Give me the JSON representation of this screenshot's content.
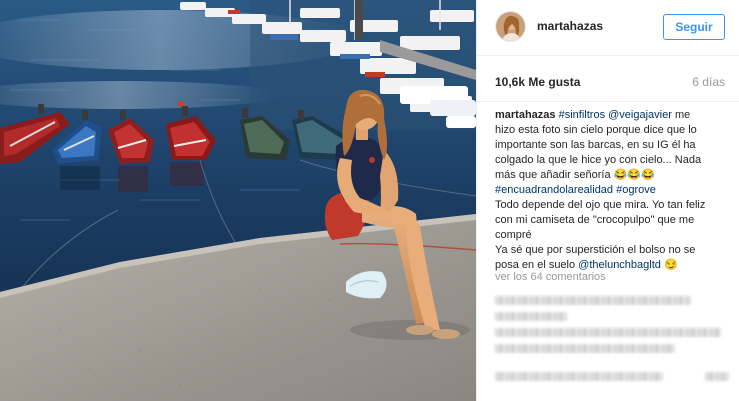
{
  "post": {
    "username": "martahazas",
    "follow_label": "Seguir",
    "likes": "10,6k Me gusta",
    "time_ago": "6 días",
    "caption_lines": [
      [
        {
          "text": "martahazas",
          "type": "user"
        },
        {
          "text": " ",
          "type": "plain"
        },
        {
          "text": "#sinfiltros",
          "type": "tag"
        },
        {
          "text": " ",
          "type": "plain"
        },
        {
          "text": "@veigajavier",
          "type": "tag"
        },
        {
          "text": " me",
          "type": "plain"
        }
      ],
      [
        {
          "text": "hizo esta foto sin cielo porque dice que lo",
          "type": "plain"
        }
      ],
      [
        {
          "text": "importante son las barcas, en su IG él ha",
          "type": "plain"
        }
      ],
      [
        {
          "text": "colgado la que le hice yo con cielo... Nada",
          "type": "plain"
        }
      ],
      [
        {
          "text": "más que añadir señoría 😂😂😂",
          "type": "plain"
        }
      ],
      [
        {
          "text": "#encuadrandolarealidad",
          "type": "tag"
        },
        {
          "text": " ",
          "type": "plain"
        },
        {
          "text": "#ogrove",
          "type": "tag"
        }
      ],
      [
        {
          "text": "Todo depende del ojo que mira. Yo tan feliz",
          "type": "plain"
        }
      ],
      [
        {
          "text": "con mi camiseta de \"crocopulpo\" que me",
          "type": "plain"
        }
      ],
      [
        {
          "text": "compré",
          "type": "plain"
        }
      ],
      [
        {
          "text": "Ya sé que por superstición el bolso no se",
          "type": "plain"
        }
      ],
      [
        {
          "text": "posa en el suelo ",
          "type": "plain"
        },
        {
          "text": "@thelunchbagltd",
          "type": "tag"
        },
        {
          "text": " 😏",
          "type": "plain"
        }
      ]
    ],
    "view_comments": "ver los 64 comentarios"
  },
  "icons": {
    "avatar": "profile-photo",
    "photo": "woman-sitting-on-pier-with-boats"
  },
  "colors": {
    "link": "#003569",
    "follow": "#3897f0",
    "muted": "#999999",
    "water": "#1d3f63",
    "pier": "#9a9690"
  }
}
